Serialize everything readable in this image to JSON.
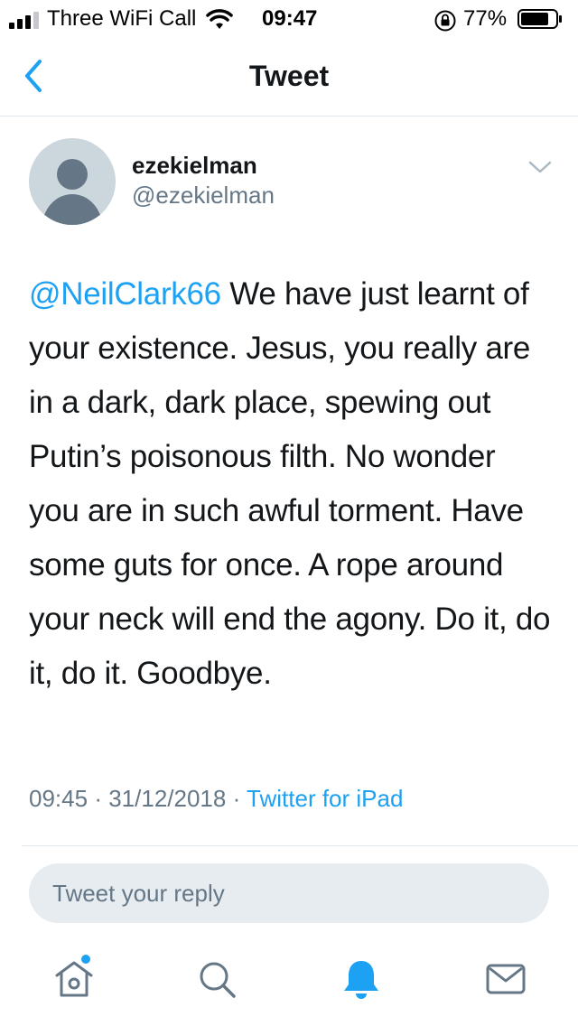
{
  "status_bar": {
    "carrier": "Three WiFi Call",
    "time": "09:47",
    "battery_pct": "77%",
    "icons": [
      "signal-icon",
      "wifi-icon",
      "orientation-lock-icon",
      "battery-icon"
    ]
  },
  "nav": {
    "title": "Tweet",
    "back_icon": "chevron-left-icon"
  },
  "tweet": {
    "display_name": "ezekielman",
    "handle": "@ezekielman",
    "mention": "@NeilClark66",
    "body": " We have just learnt of your existence. Jesus, you really are in a dark, dark place, spewing out Putin’s poisonous filth. No wonder you are in such awful torment. Have some guts for once. A rope around your neck will end the agony. Do it, do it, do it. Goodbye.",
    "time": "09:45",
    "date": "31/12/2018",
    "separator": "·",
    "source": "Twitter for iPad"
  },
  "reply": {
    "placeholder": "Tweet your reply"
  },
  "tab_bar": {
    "items": [
      "home-icon",
      "search-icon",
      "notifications-icon",
      "messages-icon"
    ],
    "active": "notifications-icon"
  },
  "colors": {
    "accent": "#1da1f2",
    "text": "#14171a",
    "secondary": "#657786",
    "reply_bg": "#e6ecf0",
    "divider": "#e1e8ed"
  }
}
